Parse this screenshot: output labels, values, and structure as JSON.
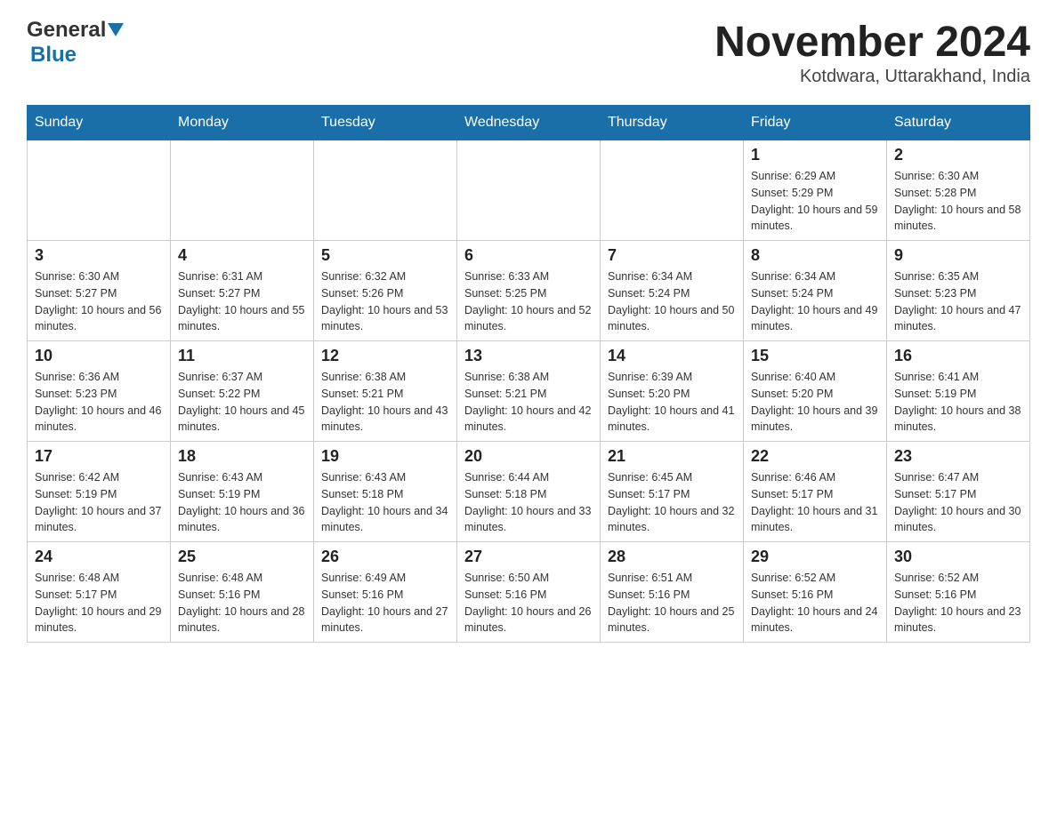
{
  "header": {
    "logo_general": "General",
    "logo_blue": "Blue",
    "month_title": "November 2024",
    "location": "Kotdwara, Uttarakhand, India"
  },
  "days_of_week": [
    "Sunday",
    "Monday",
    "Tuesday",
    "Wednesday",
    "Thursday",
    "Friday",
    "Saturday"
  ],
  "weeks": [
    [
      {
        "day": "",
        "info": ""
      },
      {
        "day": "",
        "info": ""
      },
      {
        "day": "",
        "info": ""
      },
      {
        "day": "",
        "info": ""
      },
      {
        "day": "",
        "info": ""
      },
      {
        "day": "1",
        "info": "Sunrise: 6:29 AM\nSunset: 5:29 PM\nDaylight: 10 hours and 59 minutes."
      },
      {
        "day": "2",
        "info": "Sunrise: 6:30 AM\nSunset: 5:28 PM\nDaylight: 10 hours and 58 minutes."
      }
    ],
    [
      {
        "day": "3",
        "info": "Sunrise: 6:30 AM\nSunset: 5:27 PM\nDaylight: 10 hours and 56 minutes."
      },
      {
        "day": "4",
        "info": "Sunrise: 6:31 AM\nSunset: 5:27 PM\nDaylight: 10 hours and 55 minutes."
      },
      {
        "day": "5",
        "info": "Sunrise: 6:32 AM\nSunset: 5:26 PM\nDaylight: 10 hours and 53 minutes."
      },
      {
        "day": "6",
        "info": "Sunrise: 6:33 AM\nSunset: 5:25 PM\nDaylight: 10 hours and 52 minutes."
      },
      {
        "day": "7",
        "info": "Sunrise: 6:34 AM\nSunset: 5:24 PM\nDaylight: 10 hours and 50 minutes."
      },
      {
        "day": "8",
        "info": "Sunrise: 6:34 AM\nSunset: 5:24 PM\nDaylight: 10 hours and 49 minutes."
      },
      {
        "day": "9",
        "info": "Sunrise: 6:35 AM\nSunset: 5:23 PM\nDaylight: 10 hours and 47 minutes."
      }
    ],
    [
      {
        "day": "10",
        "info": "Sunrise: 6:36 AM\nSunset: 5:23 PM\nDaylight: 10 hours and 46 minutes."
      },
      {
        "day": "11",
        "info": "Sunrise: 6:37 AM\nSunset: 5:22 PM\nDaylight: 10 hours and 45 minutes."
      },
      {
        "day": "12",
        "info": "Sunrise: 6:38 AM\nSunset: 5:21 PM\nDaylight: 10 hours and 43 minutes."
      },
      {
        "day": "13",
        "info": "Sunrise: 6:38 AM\nSunset: 5:21 PM\nDaylight: 10 hours and 42 minutes."
      },
      {
        "day": "14",
        "info": "Sunrise: 6:39 AM\nSunset: 5:20 PM\nDaylight: 10 hours and 41 minutes."
      },
      {
        "day": "15",
        "info": "Sunrise: 6:40 AM\nSunset: 5:20 PM\nDaylight: 10 hours and 39 minutes."
      },
      {
        "day": "16",
        "info": "Sunrise: 6:41 AM\nSunset: 5:19 PM\nDaylight: 10 hours and 38 minutes."
      }
    ],
    [
      {
        "day": "17",
        "info": "Sunrise: 6:42 AM\nSunset: 5:19 PM\nDaylight: 10 hours and 37 minutes."
      },
      {
        "day": "18",
        "info": "Sunrise: 6:43 AM\nSunset: 5:19 PM\nDaylight: 10 hours and 36 minutes."
      },
      {
        "day": "19",
        "info": "Sunrise: 6:43 AM\nSunset: 5:18 PM\nDaylight: 10 hours and 34 minutes."
      },
      {
        "day": "20",
        "info": "Sunrise: 6:44 AM\nSunset: 5:18 PM\nDaylight: 10 hours and 33 minutes."
      },
      {
        "day": "21",
        "info": "Sunrise: 6:45 AM\nSunset: 5:17 PM\nDaylight: 10 hours and 32 minutes."
      },
      {
        "day": "22",
        "info": "Sunrise: 6:46 AM\nSunset: 5:17 PM\nDaylight: 10 hours and 31 minutes."
      },
      {
        "day": "23",
        "info": "Sunrise: 6:47 AM\nSunset: 5:17 PM\nDaylight: 10 hours and 30 minutes."
      }
    ],
    [
      {
        "day": "24",
        "info": "Sunrise: 6:48 AM\nSunset: 5:17 PM\nDaylight: 10 hours and 29 minutes."
      },
      {
        "day": "25",
        "info": "Sunrise: 6:48 AM\nSunset: 5:16 PM\nDaylight: 10 hours and 28 minutes."
      },
      {
        "day": "26",
        "info": "Sunrise: 6:49 AM\nSunset: 5:16 PM\nDaylight: 10 hours and 27 minutes."
      },
      {
        "day": "27",
        "info": "Sunrise: 6:50 AM\nSunset: 5:16 PM\nDaylight: 10 hours and 26 minutes."
      },
      {
        "day": "28",
        "info": "Sunrise: 6:51 AM\nSunset: 5:16 PM\nDaylight: 10 hours and 25 minutes."
      },
      {
        "day": "29",
        "info": "Sunrise: 6:52 AM\nSunset: 5:16 PM\nDaylight: 10 hours and 24 minutes."
      },
      {
        "day": "30",
        "info": "Sunrise: 6:52 AM\nSunset: 5:16 PM\nDaylight: 10 hours and 23 minutes."
      }
    ]
  ]
}
